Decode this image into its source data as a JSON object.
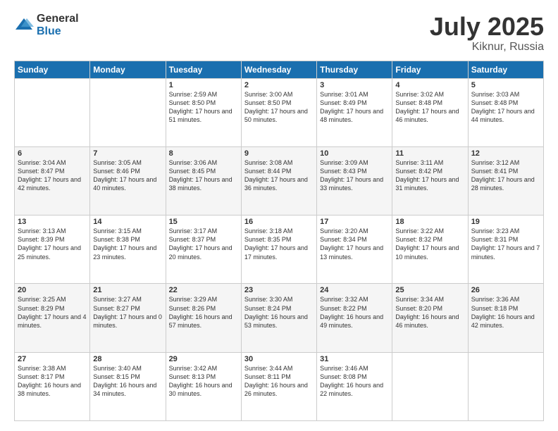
{
  "header": {
    "logo_general": "General",
    "logo_blue": "Blue",
    "month": "July 2025",
    "location": "Kiknur, Russia"
  },
  "days_of_week": [
    "Sunday",
    "Monday",
    "Tuesday",
    "Wednesday",
    "Thursday",
    "Friday",
    "Saturday"
  ],
  "weeks": [
    [
      {
        "day": "",
        "sunrise": "",
        "sunset": "",
        "daylight": ""
      },
      {
        "day": "",
        "sunrise": "",
        "sunset": "",
        "daylight": ""
      },
      {
        "day": "1",
        "sunrise": "Sunrise: 2:59 AM",
        "sunset": "Sunset: 8:50 PM",
        "daylight": "Daylight: 17 hours and 51 minutes."
      },
      {
        "day": "2",
        "sunrise": "Sunrise: 3:00 AM",
        "sunset": "Sunset: 8:50 PM",
        "daylight": "Daylight: 17 hours and 50 minutes."
      },
      {
        "day": "3",
        "sunrise": "Sunrise: 3:01 AM",
        "sunset": "Sunset: 8:49 PM",
        "daylight": "Daylight: 17 hours and 48 minutes."
      },
      {
        "day": "4",
        "sunrise": "Sunrise: 3:02 AM",
        "sunset": "Sunset: 8:48 PM",
        "daylight": "Daylight: 17 hours and 46 minutes."
      },
      {
        "day": "5",
        "sunrise": "Sunrise: 3:03 AM",
        "sunset": "Sunset: 8:48 PM",
        "daylight": "Daylight: 17 hours and 44 minutes."
      }
    ],
    [
      {
        "day": "6",
        "sunrise": "Sunrise: 3:04 AM",
        "sunset": "Sunset: 8:47 PM",
        "daylight": "Daylight: 17 hours and 42 minutes."
      },
      {
        "day": "7",
        "sunrise": "Sunrise: 3:05 AM",
        "sunset": "Sunset: 8:46 PM",
        "daylight": "Daylight: 17 hours and 40 minutes."
      },
      {
        "day": "8",
        "sunrise": "Sunrise: 3:06 AM",
        "sunset": "Sunset: 8:45 PM",
        "daylight": "Daylight: 17 hours and 38 minutes."
      },
      {
        "day": "9",
        "sunrise": "Sunrise: 3:08 AM",
        "sunset": "Sunset: 8:44 PM",
        "daylight": "Daylight: 17 hours and 36 minutes."
      },
      {
        "day": "10",
        "sunrise": "Sunrise: 3:09 AM",
        "sunset": "Sunset: 8:43 PM",
        "daylight": "Daylight: 17 hours and 33 minutes."
      },
      {
        "day": "11",
        "sunrise": "Sunrise: 3:11 AM",
        "sunset": "Sunset: 8:42 PM",
        "daylight": "Daylight: 17 hours and 31 minutes."
      },
      {
        "day": "12",
        "sunrise": "Sunrise: 3:12 AM",
        "sunset": "Sunset: 8:41 PM",
        "daylight": "Daylight: 17 hours and 28 minutes."
      }
    ],
    [
      {
        "day": "13",
        "sunrise": "Sunrise: 3:13 AM",
        "sunset": "Sunset: 8:39 PM",
        "daylight": "Daylight: 17 hours and 25 minutes."
      },
      {
        "day": "14",
        "sunrise": "Sunrise: 3:15 AM",
        "sunset": "Sunset: 8:38 PM",
        "daylight": "Daylight: 17 hours and 23 minutes."
      },
      {
        "day": "15",
        "sunrise": "Sunrise: 3:17 AM",
        "sunset": "Sunset: 8:37 PM",
        "daylight": "Daylight: 17 hours and 20 minutes."
      },
      {
        "day": "16",
        "sunrise": "Sunrise: 3:18 AM",
        "sunset": "Sunset: 8:35 PM",
        "daylight": "Daylight: 17 hours and 17 minutes."
      },
      {
        "day": "17",
        "sunrise": "Sunrise: 3:20 AM",
        "sunset": "Sunset: 8:34 PM",
        "daylight": "Daylight: 17 hours and 13 minutes."
      },
      {
        "day": "18",
        "sunrise": "Sunrise: 3:22 AM",
        "sunset": "Sunset: 8:32 PM",
        "daylight": "Daylight: 17 hours and 10 minutes."
      },
      {
        "day": "19",
        "sunrise": "Sunrise: 3:23 AM",
        "sunset": "Sunset: 8:31 PM",
        "daylight": "Daylight: 17 hours and 7 minutes."
      }
    ],
    [
      {
        "day": "20",
        "sunrise": "Sunrise: 3:25 AM",
        "sunset": "Sunset: 8:29 PM",
        "daylight": "Daylight: 17 hours and 4 minutes."
      },
      {
        "day": "21",
        "sunrise": "Sunrise: 3:27 AM",
        "sunset": "Sunset: 8:27 PM",
        "daylight": "Daylight: 17 hours and 0 minutes."
      },
      {
        "day": "22",
        "sunrise": "Sunrise: 3:29 AM",
        "sunset": "Sunset: 8:26 PM",
        "daylight": "Daylight: 16 hours and 57 minutes."
      },
      {
        "day": "23",
        "sunrise": "Sunrise: 3:30 AM",
        "sunset": "Sunset: 8:24 PM",
        "daylight": "Daylight: 16 hours and 53 minutes."
      },
      {
        "day": "24",
        "sunrise": "Sunrise: 3:32 AM",
        "sunset": "Sunset: 8:22 PM",
        "daylight": "Daylight: 16 hours and 49 minutes."
      },
      {
        "day": "25",
        "sunrise": "Sunrise: 3:34 AM",
        "sunset": "Sunset: 8:20 PM",
        "daylight": "Daylight: 16 hours and 46 minutes."
      },
      {
        "day": "26",
        "sunrise": "Sunrise: 3:36 AM",
        "sunset": "Sunset: 8:18 PM",
        "daylight": "Daylight: 16 hours and 42 minutes."
      }
    ],
    [
      {
        "day": "27",
        "sunrise": "Sunrise: 3:38 AM",
        "sunset": "Sunset: 8:17 PM",
        "daylight": "Daylight: 16 hours and 38 minutes."
      },
      {
        "day": "28",
        "sunrise": "Sunrise: 3:40 AM",
        "sunset": "Sunset: 8:15 PM",
        "daylight": "Daylight: 16 hours and 34 minutes."
      },
      {
        "day": "29",
        "sunrise": "Sunrise: 3:42 AM",
        "sunset": "Sunset: 8:13 PM",
        "daylight": "Daylight: 16 hours and 30 minutes."
      },
      {
        "day": "30",
        "sunrise": "Sunrise: 3:44 AM",
        "sunset": "Sunset: 8:11 PM",
        "daylight": "Daylight: 16 hours and 26 minutes."
      },
      {
        "day": "31",
        "sunrise": "Sunrise: 3:46 AM",
        "sunset": "Sunset: 8:08 PM",
        "daylight": "Daylight: 16 hours and 22 minutes."
      },
      {
        "day": "",
        "sunrise": "",
        "sunset": "",
        "daylight": ""
      },
      {
        "day": "",
        "sunrise": "",
        "sunset": "",
        "daylight": ""
      }
    ]
  ]
}
